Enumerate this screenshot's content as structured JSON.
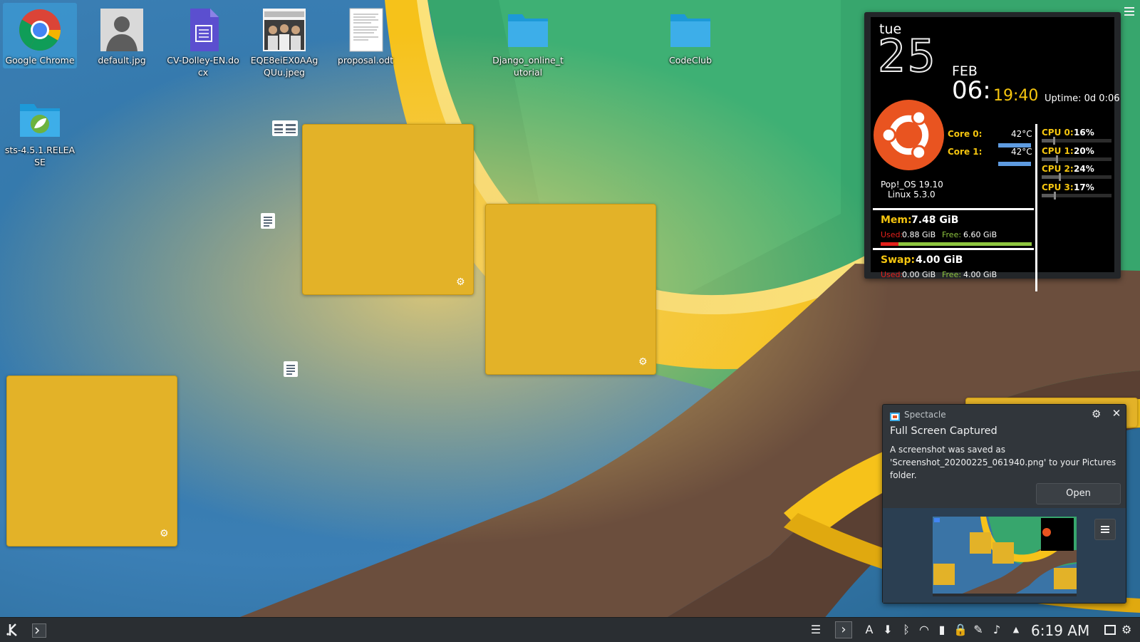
{
  "desktop": {
    "icons": [
      {
        "label": "Google Chrome",
        "icon": "chrome-icon"
      },
      {
        "label": "default.jpg",
        "icon": "image-file-icon"
      },
      {
        "label": "CV-Dolley-EN.docx",
        "icon": "document-file-icon"
      },
      {
        "label": "EQE8eiEX0AAgQUu.jpeg",
        "icon": "image-file-icon"
      },
      {
        "label": "proposal.odt",
        "icon": "text-document-icon"
      },
      {
        "label": "Django_online_tutorial",
        "icon": "folder-icon"
      },
      {
        "label": "CodeClub",
        "icon": "folder-icon"
      },
      {
        "label": "sts-4.5.1.RELEASE",
        "icon": "folder-icon"
      }
    ]
  },
  "sysmon": {
    "day": "tue",
    "date": "25",
    "month": "FEB",
    "hour": "06:",
    "minsec": "19:40",
    "uptime": "Uptime: 0d 0:06",
    "os": "Pop!_OS 19.10",
    "kernel": "Linux 5.3.0",
    "cores": [
      {
        "label": "Core 0:",
        "temp": "42°C"
      },
      {
        "label": "Core 1:",
        "temp": "42°C"
      }
    ],
    "cpus": [
      {
        "label": "CPU 0:",
        "value": "16%",
        "level": 0.16
      },
      {
        "label": "CPU 1:",
        "value": "20%",
        "level": 0.2
      },
      {
        "label": "CPU 2:",
        "value": "24%",
        "level": 0.24
      },
      {
        "label": "CPU 3:",
        "value": "17%",
        "level": 0.17
      }
    ],
    "mem": {
      "label": "Mem:",
      "total": "7.48 GiB",
      "used_label": "Used:",
      "used": "0.88 GiB",
      "free_label": "Free:",
      "free": "6.60 GiB",
      "used_level": 0.12
    },
    "swap": {
      "label": "Swap:",
      "total": "4.00 GiB",
      "used_label": "Used:",
      "used": "0.00 GiB",
      "free_label": "Free:",
      "free": "4.00 GiB",
      "used_level": 0.0
    },
    "colors": {
      "label_yellow": "#f5c50f",
      "accent_green": "#8ec53f",
      "used_red": "#e3201b",
      "bar_blue": "#5e9be0",
      "ubuntu_orange": "#e95420"
    }
  },
  "notification": {
    "app": "Spectacle",
    "title": "Full Screen Captured",
    "body_line1": "A screenshot was saved as",
    "body_line2": "'Screenshot_20200225_061940.png' to your Pictures",
    "body_line3": "folder.",
    "open_label": "Open"
  },
  "panel": {
    "clock": "6:19 AM",
    "tray_icons": [
      "notes-icon",
      "arrow-icon",
      "keyboard-layout-icon",
      "updates-icon",
      "bluetooth-icon",
      "wifi-icon",
      "battery-icon",
      "lock-icon",
      "clipboard-icon",
      "volume-icon",
      "expand-tray-icon"
    ]
  }
}
